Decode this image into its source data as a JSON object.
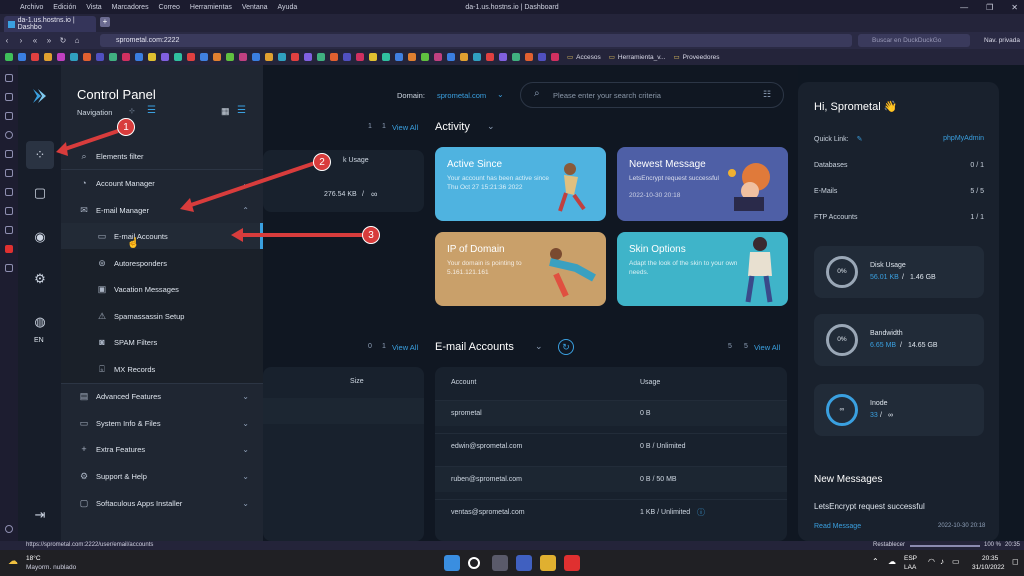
{
  "browser": {
    "menu": [
      "Archivo",
      "Edición",
      "Vista",
      "Marcadores",
      "Correo",
      "Herramientas",
      "Ventana",
      "Ayuda"
    ],
    "window_title": "da-1.us.hostns.io | Dashboard",
    "tab_label": "da-1.us.hostns.io | Dashbo",
    "url": "sprometal.com:2222",
    "search_placeholder": "Buscar en DuckDuckGo",
    "private_label": "Nav. privada",
    "bookmarks": [
      "Accesos",
      "Herramienta_v...",
      "Proveedores"
    ],
    "status_url": "https://sprometal.com:2222/user/email/accounts",
    "reset_label": "Restablecer",
    "zoom": "100 %",
    "clock_small": "20:35"
  },
  "app": {
    "title": "Control Panel",
    "nav_label": "Navigation",
    "lang": "EN",
    "domain_label": "Domain:",
    "domain_value": "sprometal.com",
    "search_placeholder": "Please enter your search criteria"
  },
  "menu": {
    "filter": "Elements filter",
    "account_manager": "Account Manager",
    "email_manager": "E-mail Manager",
    "sub": [
      "E-mail Accounts",
      "Autoresponders",
      "Vacation Messages",
      "Spamassassin Setup",
      "SPAM Filters",
      "MX Records"
    ],
    "advanced": "Advanced Features",
    "sysinfo": "System Info & Files",
    "extra": "Extra Features",
    "support": "Support & Help",
    "softaculous": "Softaculous Apps Installer"
  },
  "main": {
    "top_counter": "1",
    "top_counter2": "1",
    "view_all": "View All",
    "activity": "Activity",
    "disk_usage_label": "k Usage",
    "disk_usage_value": "276.54 KB",
    "disk_usage_sep": "/",
    "disk_usage_inf": "∞",
    "cards": [
      {
        "title": "Active Since",
        "text": "Your account has been active since Thu Oct 27 15:21:36 2022",
        "color": "#4fb3e0"
      },
      {
        "title": "Newest Message",
        "text": "LetsEncrypt request successful",
        "date": "2022-10-30 20:18",
        "color": "#4e5fa6"
      },
      {
        "title": "IP of Domain",
        "text": "Your domain is pointing to 5.161.121.161",
        "color": "#c9a06a"
      },
      {
        "title": "Skin Options",
        "text": "Adapt the look of the skin to your own needs.",
        "color": "#3fb4c9"
      }
    ],
    "bottom_counter_left": "0",
    "bottom_counter_left2": "1",
    "size_header": "Size",
    "email_title": "E-mail Accounts",
    "email_counter": "5",
    "email_counter2": "5",
    "col_account": "Account",
    "col_usage": "Usage",
    "rows": [
      {
        "account": "sprometal",
        "usage": "0 B"
      },
      {
        "account": "edwin@sprometal.com",
        "usage": "0 B / Unlimited"
      },
      {
        "account": "ruben@sprometal.com",
        "usage": "0 B / 50 MB"
      },
      {
        "account": "ventas@sprometal.com",
        "usage": "1 KB / Unlimited"
      }
    ]
  },
  "right": {
    "greeting": "Hi, Sprometal 👋",
    "quick_link": "Quick Link:",
    "quick_link_value": "phpMyAdmin",
    "stats": [
      {
        "label": "Databases",
        "value": "0 / 1"
      },
      {
        "label": "E-Mails",
        "value": "5 / 5"
      },
      {
        "label": "FTP Accounts",
        "value": "1 / 1"
      }
    ],
    "gauges": [
      {
        "label": "Disk Usage",
        "pct": "0%",
        "used": "56.01 KB",
        "total": "1.46 GB"
      },
      {
        "label": "Bandwidth",
        "pct": "0%",
        "used": "6.65 MB",
        "total": "14.65 GB"
      },
      {
        "label": "Inode",
        "pct": "∞",
        "used": "33",
        "total": "∞"
      }
    ],
    "new_messages": "New Messages",
    "message": "LetsEncrypt request successful",
    "read_message": "Read Message",
    "message_date": "2022-10-30 20:18"
  },
  "taskbar": {
    "temp": "18°C",
    "weather": "Mayorm. nublado",
    "lang1": "ESP",
    "lang2": "LAA",
    "time": "20:35",
    "date": "31/10/2022"
  },
  "callouts": [
    "1",
    "2",
    "3"
  ],
  "colors": {
    "accent": "#3aa0e0",
    "arrow": "#d83c3c"
  }
}
